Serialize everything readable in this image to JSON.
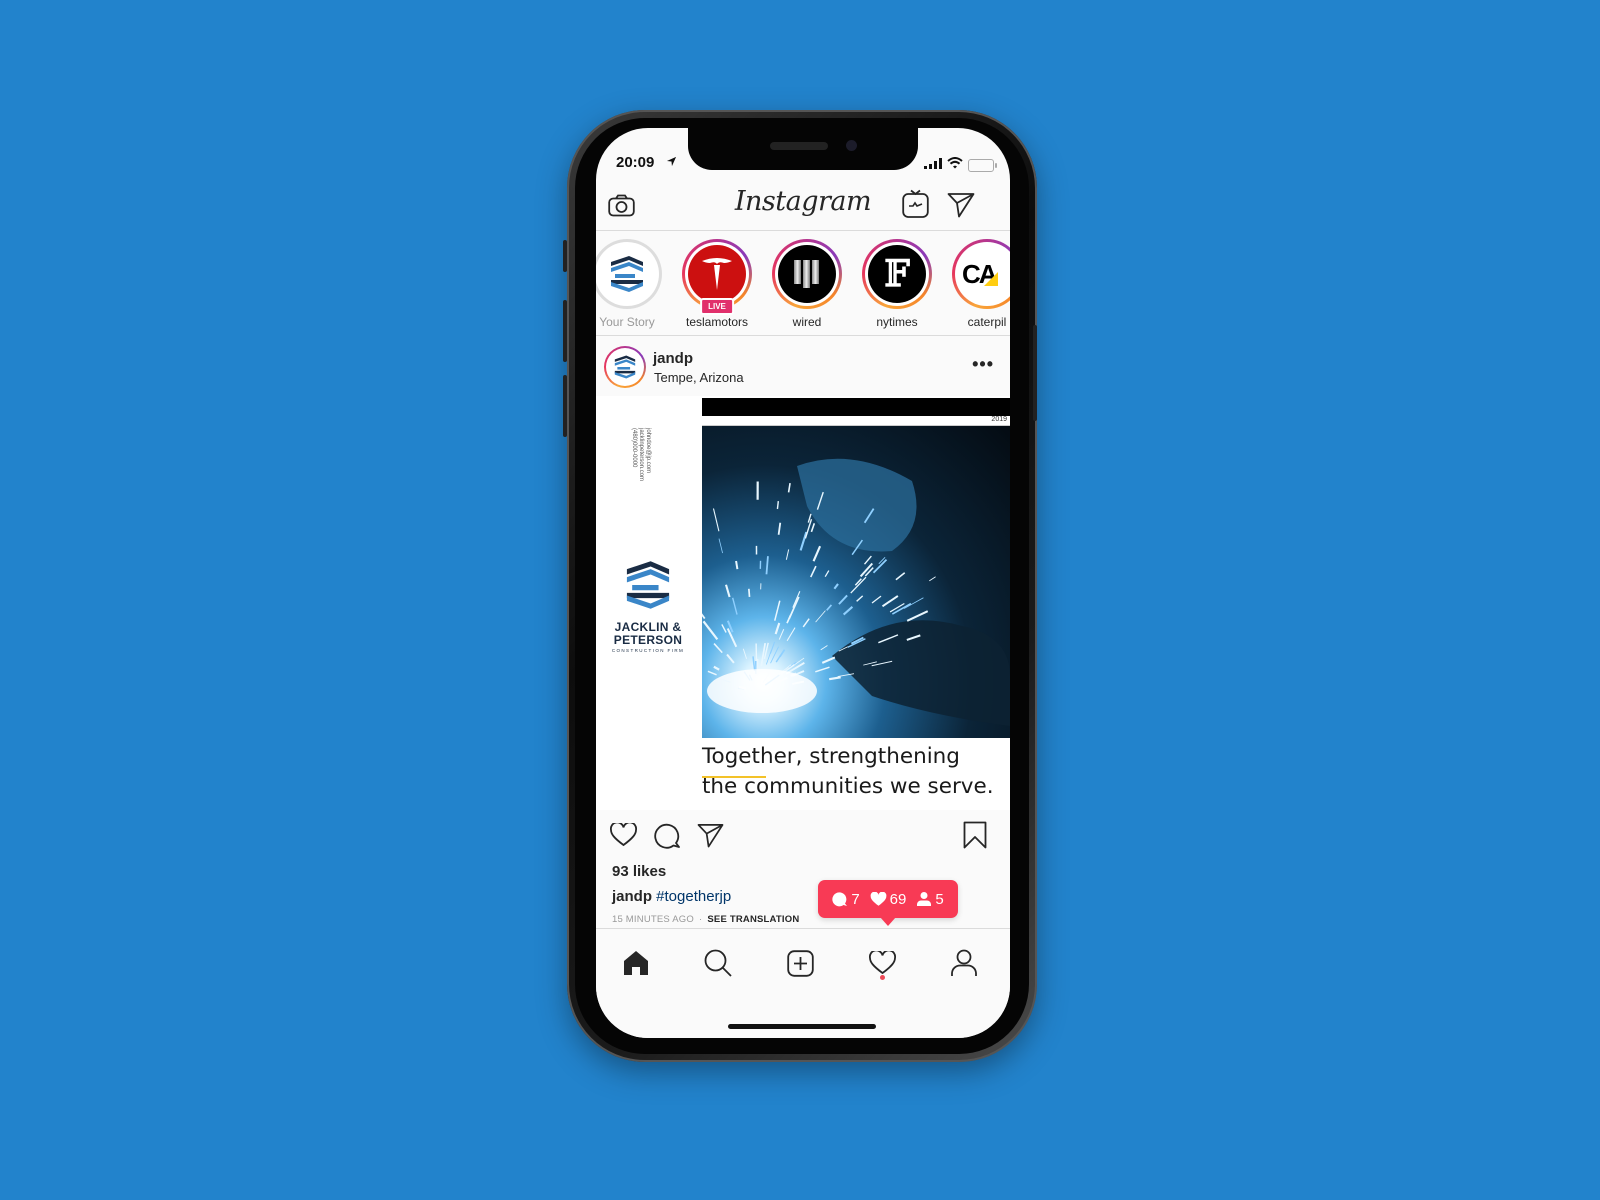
{
  "status_bar": {
    "time": "20:09",
    "location_icon": "location-arrow-icon",
    "signal_icon": "cellular-signal-icon",
    "wifi_icon": "wifi-icon",
    "battery_icon": "battery-icon"
  },
  "header": {
    "title": "Instagram",
    "camera_icon": "camera-icon",
    "igtv_icon": "igtv-icon",
    "direct_icon": "paper-plane-icon"
  },
  "stories": [
    {
      "label": "Your Story",
      "ring": "none",
      "avatar": "jandp-logo"
    },
    {
      "label": "teslamotors",
      "ring": "gradient",
      "avatar": "tesla-logo",
      "badge": "LIVE"
    },
    {
      "label": "wired",
      "ring": "gradient",
      "avatar": "wired-logo"
    },
    {
      "label": "nytimes",
      "ring": "gradient",
      "avatar": "nytimes-logo"
    },
    {
      "label": "caterpil",
      "ring": "gradient",
      "avatar": "caterpillar-logo"
    }
  ],
  "post": {
    "username": "jandp",
    "location": "Tempe, Arizona",
    "more_icon": "more-horizontal-icon",
    "image": {
      "contact_lines": [
        "johndoe@jp.com",
        "jacklinpeterson.com",
        "(480)000-0000"
      ],
      "brand_name_line1": "JACKLIN &",
      "brand_name_line2": "PETERSON",
      "brand_subtitle": "CONSTRUCTION FIRM",
      "year": "2019",
      "headline": "Together, strengthening the communities we serve.",
      "accent_color": "#f3c229"
    },
    "likes": "93 likes",
    "caption_user": "jandp",
    "caption_hashtag": "#togetherjp",
    "time_ago": "15 MINUTES AGO",
    "separator": "·",
    "see_translation": "SEE TRANSLATION"
  },
  "notification_toast": {
    "comments": "7",
    "likes": "69",
    "follows": "5",
    "color": "#f83a55"
  },
  "tab_bar": [
    {
      "name": "home",
      "icon": "home-icon",
      "active": true
    },
    {
      "name": "search",
      "icon": "search-icon"
    },
    {
      "name": "new-post",
      "icon": "plus-square-icon"
    },
    {
      "name": "activity",
      "icon": "heart-icon",
      "has_dot": true
    },
    {
      "name": "profile",
      "icon": "user-icon"
    }
  ],
  "colors": {
    "background": "#2283cc",
    "gradient_ring": [
      "#f9a53a",
      "#e6365e",
      "#c13584",
      "#8a3ab9"
    ],
    "live_badge": "#e1306c",
    "hashtag": "#003569"
  }
}
